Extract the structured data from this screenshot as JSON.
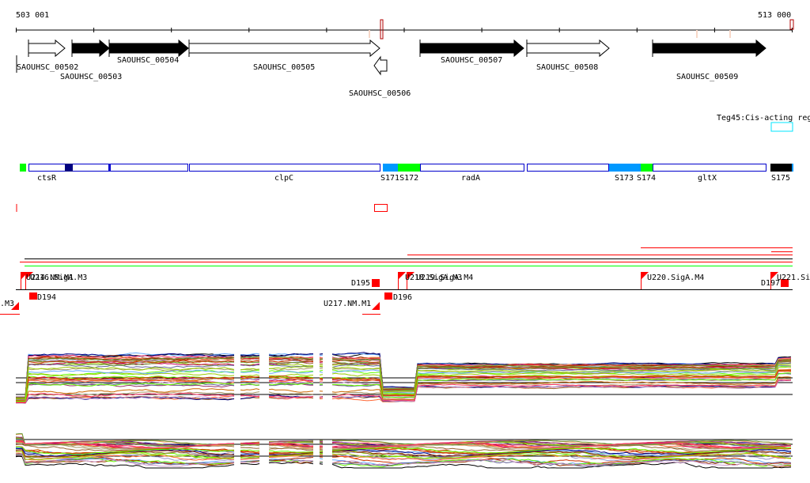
{
  "ruler": {
    "start_label": "503 001",
    "end_label": "513 000"
  },
  "genes": [
    {
      "id": "SAOUHSC_00502",
      "strand": "+",
      "fill": "white"
    },
    {
      "id": "SAOUHSC_00503",
      "strand": "+",
      "fill": "black"
    },
    {
      "id": "SAOUHSC_00504",
      "strand": "+",
      "fill": "black"
    },
    {
      "id": "SAOUHSC_00505",
      "strand": "+",
      "fill": "white"
    },
    {
      "id": "SAOUHSC_00506",
      "strand": "-",
      "fill": "white"
    },
    {
      "id": "SAOUHSC_00507",
      "strand": "+",
      "fill": "black"
    },
    {
      "id": "SAOUHSC_00508",
      "strand": "+",
      "fill": "white"
    },
    {
      "id": "SAOUHSC_00509",
      "strand": "+",
      "fill": "black"
    }
  ],
  "regulatory": {
    "label": "Teg45:Cis-acting reg",
    "color": "#00e5ff"
  },
  "operon_labels": [
    "ctsR",
    "clpC",
    "S171S172",
    "radA",
    "S173",
    "S174",
    "gltX",
    "S175"
  ],
  "promoters": {
    "upper": [
      "U214.NM.M1",
      "U216.SigA.M3",
      "D195",
      "U218.SigA.M3",
      "U219.SigA.M4",
      "U220.SigA.M4",
      "D197",
      "U221.Si"
    ],
    "lower": [
      ".M3",
      "D194",
      "U217.NM.M1",
      "D196"
    ]
  },
  "colors": {
    "gene_outline": "#0000cc",
    "light_blue": "#0099ff",
    "green": "#00ff00",
    "navy": "#000080",
    "red": "#ff0000",
    "cyan": "#00e5ff"
  }
}
